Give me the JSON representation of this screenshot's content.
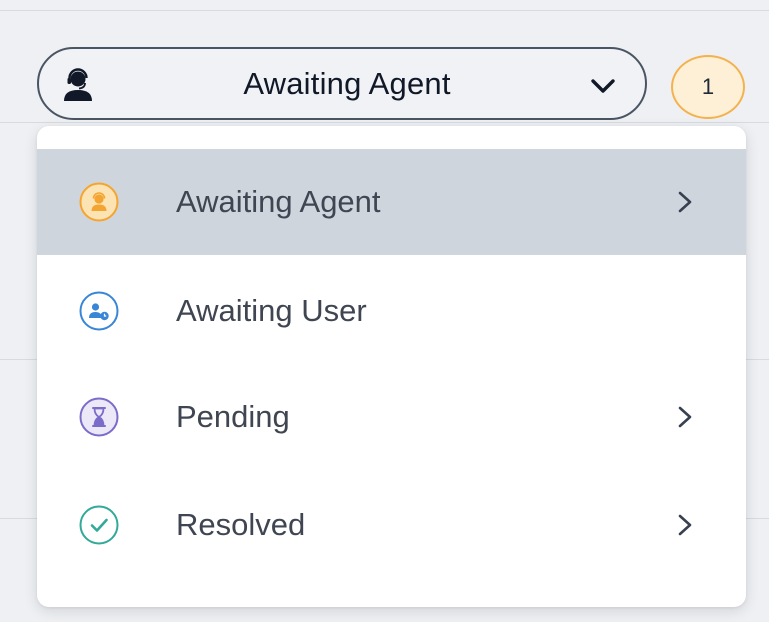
{
  "status_select": {
    "icon": "agent-headset-icon",
    "label": "Awaiting Agent",
    "chevron_icon": "chevron-down-icon"
  },
  "count_badge": {
    "value": "1"
  },
  "menu": {
    "items": [
      {
        "label": "Awaiting Agent",
        "icon": "agent-headset-icon",
        "color": "#f4a531",
        "has_submenu": true,
        "selected": true
      },
      {
        "label": "Awaiting User",
        "icon": "user-clock-icon",
        "color": "#3a86d6",
        "has_submenu": false,
        "selected": false
      },
      {
        "label": "Pending",
        "icon": "hourglass-icon",
        "color": "#7c6cc9",
        "has_submenu": true,
        "selected": false
      },
      {
        "label": "Resolved",
        "icon": "check-icon",
        "color": "#33a99a",
        "has_submenu": true,
        "selected": false
      }
    ]
  },
  "colors": {
    "selected_row": "#cfd5dd",
    "badge_border": "#f4b24f",
    "badge_fill": "#fdf0d6"
  }
}
